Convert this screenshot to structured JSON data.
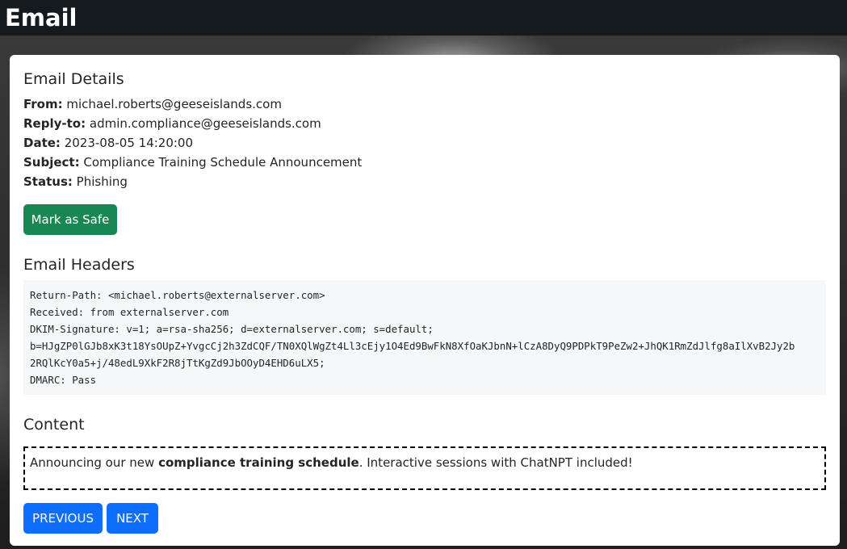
{
  "header": {
    "title": "Email"
  },
  "details": {
    "heading": "Email Details",
    "from_label": "From:",
    "from_value": "michael.roberts@geeseislands.com",
    "reply_to_label": "Reply-to:",
    "reply_to_value": "admin.compliance@geeseislands.com",
    "date_label": "Date:",
    "date_value": "2023-08-05 14:20:00",
    "subject_label": "Subject:",
    "subject_value": "Compliance Training Schedule Announcement",
    "status_label": "Status:",
    "status_value": "Phishing",
    "mark_safe_label": "Mark as Safe"
  },
  "headers": {
    "heading": "Email Headers",
    "lines": [
      "Return-Path: <michael.roberts@externalserver.com>",
      "Received: from externalserver.com",
      "DKIM-Signature: v=1; a=rsa-sha256; d=externalserver.com; s=default;",
      "b=HJgZP0lGJb8xK3t18YsOUpZ+YvgcCj2h3ZdCQF/TN0XQlWgZt4Ll3cEjy1O4Ed9BwFkN8XfOaKJbnN+lCzA8DyQ9PDPkT9PeZw2+JhQK1RmZdJlfg8aIlXvB2Jy2b",
      "2RQlKcY0a5+j/48edL9XkF2R8jTtKgZd9JbOOyD4EHD6uLX5;",
      "DMARC: Pass"
    ]
  },
  "content": {
    "heading": "Content",
    "text_before": "Announcing our new ",
    "text_bold": "compliance training schedule",
    "text_after": ". Interactive sessions with ChatNPT included!"
  },
  "nav": {
    "previous_label": "PREVIOUS",
    "next_label": "NEXT"
  },
  "colors": {
    "topbar": "#141a1e",
    "safe_button": "#198754",
    "nav_button": "#0d6efd",
    "headers_bg": "#f6f7f8"
  }
}
